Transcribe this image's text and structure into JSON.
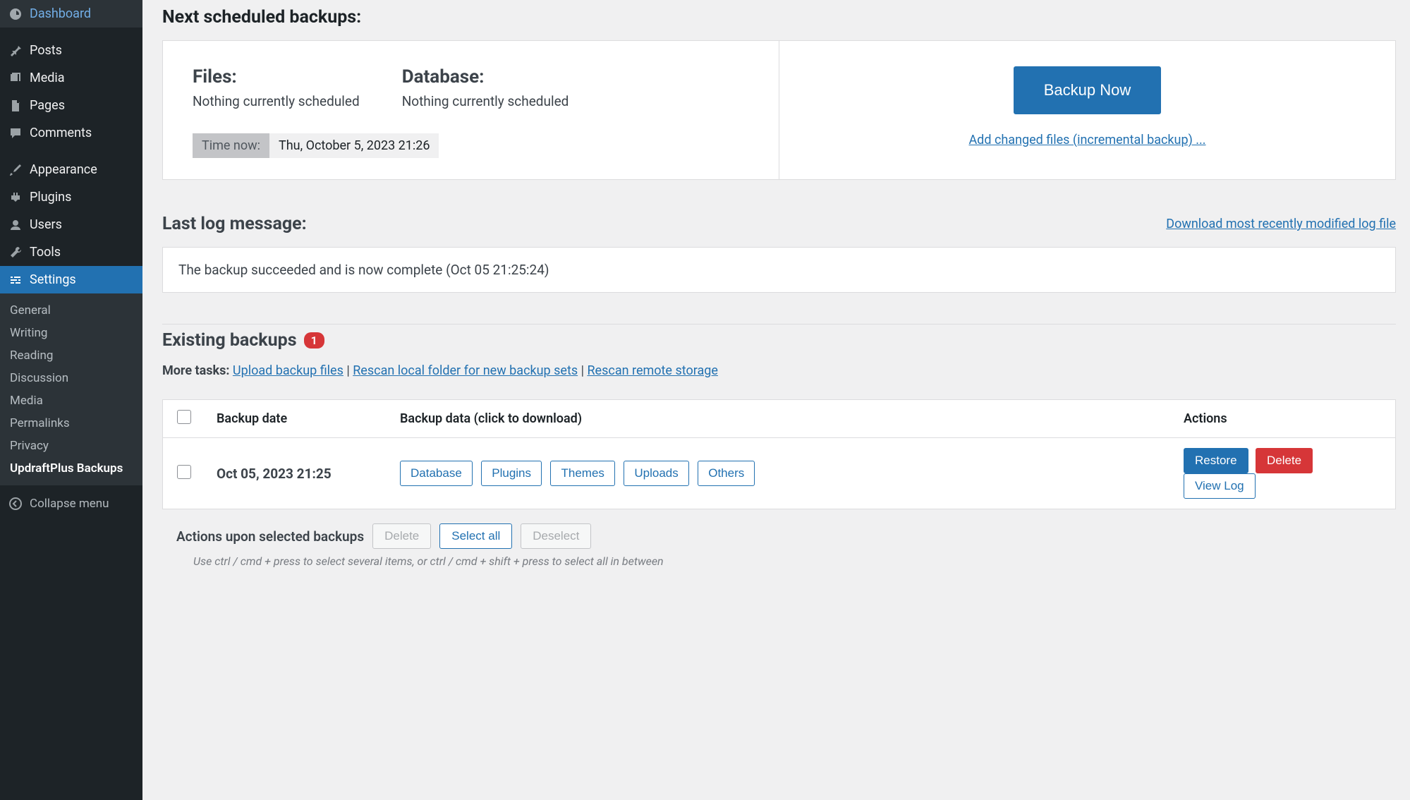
{
  "sidebar": {
    "items": [
      {
        "label": "Dashboard"
      },
      {
        "label": "Posts"
      },
      {
        "label": "Media"
      },
      {
        "label": "Pages"
      },
      {
        "label": "Comments"
      },
      {
        "label": "Appearance"
      },
      {
        "label": "Plugins"
      },
      {
        "label": "Users"
      },
      {
        "label": "Tools"
      },
      {
        "label": "Settings"
      }
    ],
    "submenu": [
      {
        "label": "General"
      },
      {
        "label": "Writing"
      },
      {
        "label": "Reading"
      },
      {
        "label": "Discussion"
      },
      {
        "label": "Media"
      },
      {
        "label": "Permalinks"
      },
      {
        "label": "Privacy"
      },
      {
        "label": "UpdraftPlus Backups"
      }
    ],
    "collapse": "Collapse menu"
  },
  "scheduled": {
    "heading": "Next scheduled backups:",
    "files_label": "Files:",
    "files_status": "Nothing currently scheduled",
    "db_label": "Database:",
    "db_status": "Nothing currently scheduled",
    "time_label": "Time now:",
    "time_value": "Thu, October 5, 2023 21:26",
    "backup_btn": "Backup Now",
    "incremental_link": "Add changed files (incremental backup) ..."
  },
  "log": {
    "heading": "Last log message:",
    "download_link": "Download most recently modified log file",
    "message": "The backup succeeded and is now complete (Oct 05 21:25:24)"
  },
  "existing": {
    "heading": "Existing backups",
    "count": "1",
    "more_tasks_label": "More tasks:",
    "upload_link": "Upload backup files",
    "rescan_local": "Rescan local folder for new backup sets",
    "rescan_remote": "Rescan remote storage",
    "col_date": "Backup date",
    "col_data": "Backup data (click to download)",
    "col_actions": "Actions",
    "row_date": "Oct 05, 2023 21:25",
    "chips": [
      "Database",
      "Plugins",
      "Themes",
      "Uploads",
      "Others"
    ],
    "restore": "Restore",
    "delete": "Delete",
    "viewlog": "View Log"
  },
  "selected": {
    "label": "Actions upon selected backups",
    "delete": "Delete",
    "select_all": "Select all",
    "deselect": "Deselect",
    "hint": "Use ctrl / cmd + press to select several items, or ctrl / cmd + shift + press to select all in between"
  }
}
